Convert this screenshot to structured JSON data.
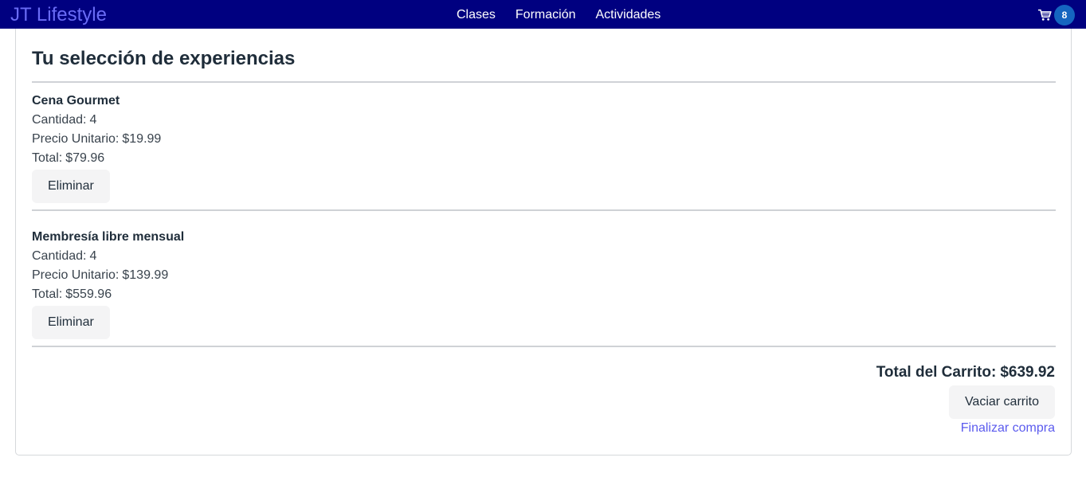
{
  "brand": {
    "name": "JT Lifestyle"
  },
  "nav": {
    "links": [
      {
        "label": "Clases"
      },
      {
        "label": "Formación"
      },
      {
        "label": "Actividades"
      }
    ],
    "cart_count": "8"
  },
  "cart": {
    "title": "Tu selección de experiencias",
    "items": [
      {
        "name": "Cena Gourmet",
        "quantity_label": "Cantidad:",
        "quantity": "4",
        "unit_price_label": "Precio Unitario:",
        "unit_price": "$19.99",
        "total_label": "Total:",
        "total": "$79.96",
        "remove_label": "Eliminar"
      },
      {
        "name": "Membresía libre mensual",
        "quantity_label": "Cantidad:",
        "quantity": "4",
        "unit_price_label": "Precio Unitario:",
        "unit_price": "$139.99",
        "total_label": "Total:",
        "total": "$559.96",
        "remove_label": "Eliminar"
      }
    ],
    "total_label": "Total del Carrito:",
    "total_value": "$639.92",
    "empty_label": "Vaciar carrito",
    "checkout_label": "Finalizar compra"
  },
  "colors": {
    "navbar": "#000080",
    "brand": "#6a6cf6",
    "badge": "#1565c0",
    "link": "#5b5bee",
    "button_bg": "#f4f4f5"
  },
  "icons": {
    "cart": "shopping-cart-icon"
  }
}
